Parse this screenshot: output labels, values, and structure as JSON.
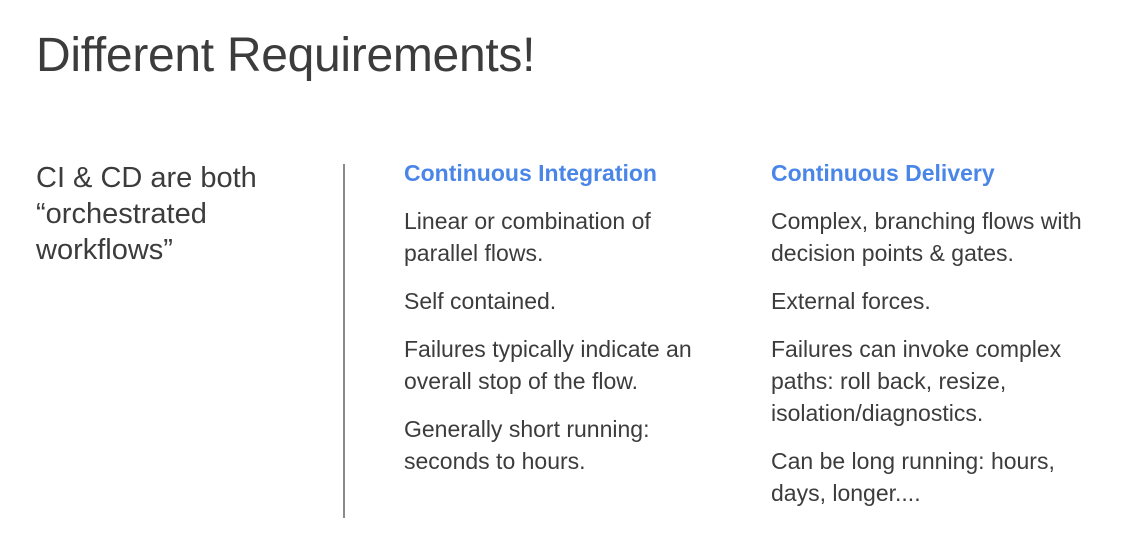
{
  "title": "Different Requirements!",
  "intro": {
    "lines": [
      "CI & CD are both",
      "“orchestrated",
      "workflows”"
    ]
  },
  "columns": [
    {
      "heading": "Continuous Integration",
      "points": [
        [
          "Linear or combination of",
          "parallel flows."
        ],
        [
          "Self contained."
        ],
        [
          "Failures typically indicate an",
          "overall stop of the flow."
        ],
        [
          "Generally short running:",
          "seconds to hours."
        ]
      ]
    },
    {
      "heading": "Continuous Delivery",
      "points": [
        [
          "Complex, branching flows with",
          "decision points & gates."
        ],
        [
          "External forces."
        ],
        [
          "Failures can invoke complex",
          "paths: roll back, resize,",
          "isolation/diagnostics."
        ],
        [
          "Can be long running: hours,",
          "days, longer...."
        ]
      ]
    }
  ],
  "colors": {
    "heading_accent": "#4a86e8",
    "text": "#3c3c3c",
    "divider": "#8a8a8a"
  }
}
